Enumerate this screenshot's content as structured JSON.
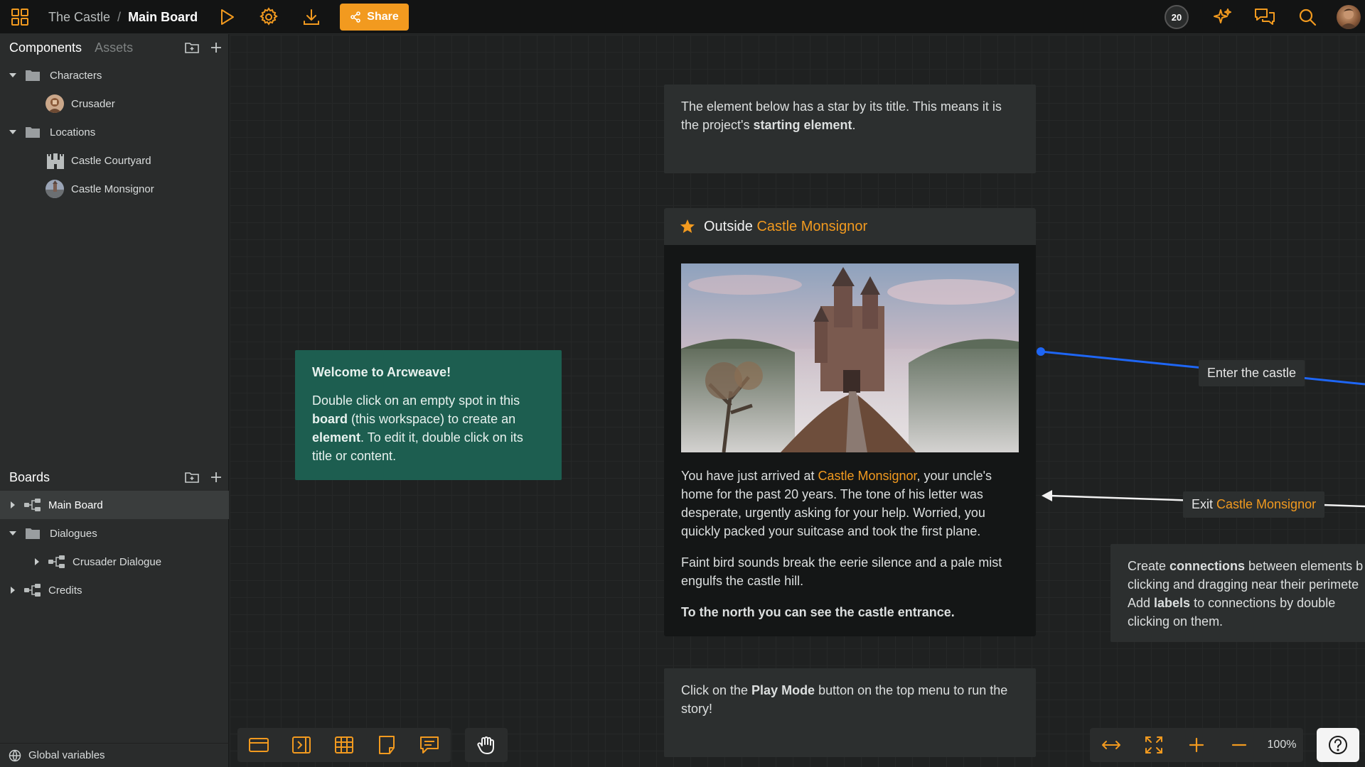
{
  "topbar": {
    "project_name": "The Castle",
    "separator": "/",
    "board_name": "Main Board",
    "share_label": "Share",
    "credits_badge": "20",
    "icons": [
      "apps-grid-icon",
      "play-icon",
      "settings-gear-icon",
      "download-icon",
      "share-icon",
      "sparkle-icon",
      "comments-icon",
      "search-icon"
    ]
  },
  "sidebar": {
    "tabs": {
      "components": "Components",
      "assets": "Assets"
    },
    "components_tree": [
      {
        "label": "Characters",
        "type": "folder"
      },
      {
        "label": "Crusader",
        "type": "character"
      },
      {
        "label": "Locations",
        "type": "folder"
      },
      {
        "label": "Castle Courtyard",
        "type": "location"
      },
      {
        "label": "Castle Monsignor",
        "type": "location"
      }
    ],
    "boards_title": "Boards",
    "boards_tree": [
      {
        "label": "Main Board",
        "type": "board",
        "selected": true
      },
      {
        "label": "Dialogues",
        "type": "folder"
      },
      {
        "label": "Crusader Dialogue",
        "type": "board"
      },
      {
        "label": "Credits",
        "type": "board"
      }
    ],
    "footer_label": "Global variables"
  },
  "canvas": {
    "note_top": {
      "text1": "The element below has a star by its title. This means it is the project's ",
      "bold": "starting element",
      "text2": "."
    },
    "element": {
      "title_prefix": "Outside ",
      "title_link": "Castle Monsignor",
      "para1_a": "You have just arrived at ",
      "para1_link": "Castle Monsignor",
      "para1_b": ", your uncle's home for the past 20 years. The tone of his letter was desperate, urgently asking for your help. Worried, you quickly packed your suitcase and took the first plane.",
      "para2": "Faint bird sounds break the eerie silence and a pale mist engulfs the castle hill.",
      "para3": "To the north you can see the castle entrance."
    },
    "welcome": {
      "title": "Welcome to Arcweave!",
      "t1": "Double click on an empty spot in this ",
      "b1": "board",
      "t2": " (this workspace) to create an ",
      "b2": "element",
      "t3": ". To edit it, double click on its title or content."
    },
    "connection_labels": {
      "enter": "Enter the castle",
      "exit_prefix": "Exit ",
      "exit_link": "Castle Monsignor"
    },
    "note_right": {
      "t1": "Create ",
      "b1": "connections",
      "t2": " between elements b",
      "line2": "clicking and dragging near their perimete",
      "t3": "Add ",
      "b2": "labels",
      "t4": " to connections by double",
      "line4": "clicking on them."
    },
    "note_bottom": {
      "t1": "Click on the ",
      "b1": "Play Mode",
      "t2": " button on the top menu to run the story!"
    }
  },
  "zoom_level": "100%",
  "colors": {
    "accent": "#f29a1f",
    "connection": "#1e66f5",
    "welcome_bg": "#1d5e50"
  }
}
